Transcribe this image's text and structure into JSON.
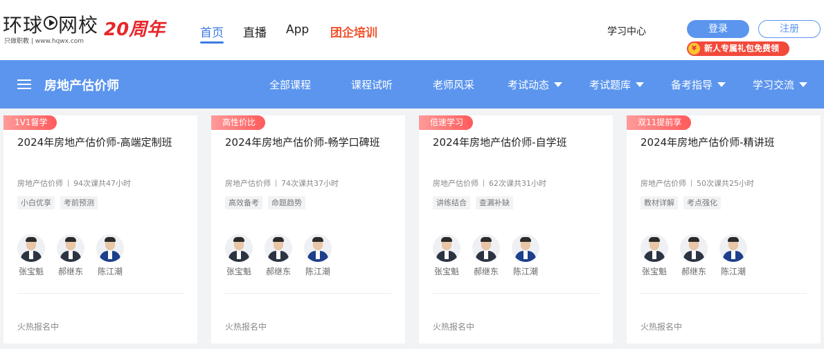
{
  "header": {
    "logo_text_a": "环球",
    "logo_text_b": "网校",
    "logo_slogan": "只做职教 | www.hqwx.com",
    "anniversary": "20周年",
    "nav": [
      "首页",
      "直播",
      "App",
      "团企培训"
    ],
    "study_center": "学习中心",
    "login": "登录",
    "register": "注册",
    "promo": "新人专属礼包免费领",
    "promo_coin": "¥"
  },
  "bluebar": {
    "title": "房地产估价师",
    "nav": [
      {
        "label": "全部课程",
        "dropdown": false
      },
      {
        "label": "课程试听",
        "dropdown": false
      },
      {
        "label": "老师风采",
        "dropdown": false
      },
      {
        "label": "考试动态",
        "dropdown": true
      },
      {
        "label": "考试题库",
        "dropdown": true
      },
      {
        "label": "备考指导",
        "dropdown": true
      },
      {
        "label": "学习交流",
        "dropdown": true
      }
    ]
  },
  "cards": [
    {
      "badge": "1V1督学",
      "title": "2024年房地产估价师-高端定制班",
      "category": "房地产估价师",
      "lessons": "94次课共47小时",
      "tags": [
        "小白优享",
        "考前预测"
      ],
      "teachers": [
        "张宝魁",
        "郝继东",
        "陈江潮"
      ],
      "status": "火热报名中"
    },
    {
      "badge": "高性价比",
      "title": "2024年房地产估价师-畅学口碑班",
      "category": "房地产估价师",
      "lessons": "74次课共37小时",
      "tags": [
        "高效备考",
        "命题趋势"
      ],
      "teachers": [
        "张宝魁",
        "郝继东",
        "陈江潮"
      ],
      "status": "火热报名中"
    },
    {
      "badge": "倍速学习",
      "title": "2024年房地产估价师-自学班",
      "category": "房地产估价师",
      "lessons": "62次课共31小时",
      "tags": [
        "讲练结合",
        "查漏补缺"
      ],
      "teachers": [
        "张宝魁",
        "郝继东",
        "陈江潮"
      ],
      "status": "火热报名中"
    },
    {
      "badge": "双11提前享",
      "title": "2024年房地产估价师-精讲班",
      "category": "房地产估价师",
      "lessons": "50次课共25小时",
      "tags": [
        "教材详解",
        "考点强化"
      ],
      "teachers": [
        "张宝魁",
        "郝继东",
        "陈江潮"
      ],
      "status": "火热报名中"
    }
  ],
  "colors": {
    "brand_blue": "#5b95ee",
    "accent_red": "#e8262b",
    "hot_orange": "#f2532c"
  }
}
